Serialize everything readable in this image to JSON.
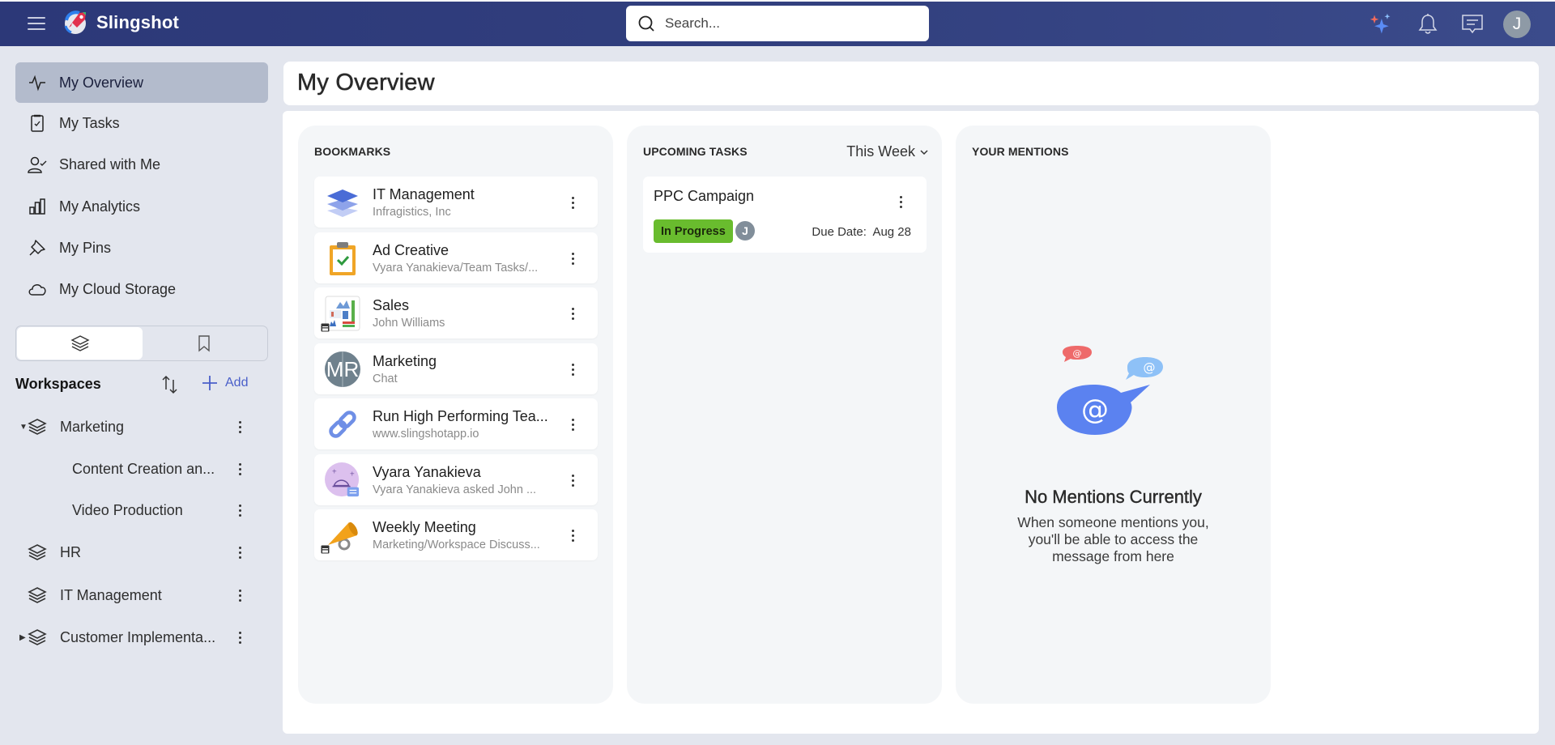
{
  "app": {
    "brand": "Slingshot",
    "search_placeholder": "Search...",
    "user_initial": "J",
    "colors": {
      "header": "#2f3b7a",
      "accent": "#4a5fc9",
      "in_progress": "#69bc2e",
      "active_nav": "#b3bbcc"
    }
  },
  "sidebar": {
    "nav": [
      {
        "label": "My Overview",
        "icon": "activity-icon",
        "active": true
      },
      {
        "label": "My Tasks",
        "icon": "clipboard-check-icon"
      },
      {
        "label": "Shared with Me",
        "icon": "user-check-icon"
      },
      {
        "label": "My Analytics",
        "icon": "bar-chart-icon"
      },
      {
        "label": "My Pins",
        "icon": "pin-icon"
      },
      {
        "label": "My Cloud Storage",
        "icon": "cloud-icon"
      }
    ],
    "toggle": {
      "selected": "workspaces",
      "options": [
        "workspaces",
        "bookmarks"
      ]
    },
    "workspaces_title": "Workspaces",
    "add_label": "Add",
    "tree": [
      {
        "label": "Marketing",
        "level": 0,
        "expanded": true,
        "has_children": true
      },
      {
        "label": "Content Creation an...",
        "level": 1
      },
      {
        "label": "Video Production",
        "level": 1
      },
      {
        "label": "HR",
        "level": 0
      },
      {
        "label": "IT Management",
        "level": 0
      },
      {
        "label": "Customer Implementa...",
        "level": 0,
        "expanded": false,
        "has_children": true
      }
    ]
  },
  "main": {
    "title": "My Overview",
    "bookmarks": {
      "title": "BOOKMARKS",
      "items": [
        {
          "title": "IT Management",
          "subtitle": "Infragistics, Inc",
          "icon": "workspace-layers-icon"
        },
        {
          "title": "Ad Creative",
          "subtitle": "Vyara Yanakieva/Team Tasks/...",
          "icon": "task-clipboard-icon"
        },
        {
          "title": "Sales",
          "subtitle": "John Williams",
          "icon": "dashboard-thumbnail-icon"
        },
        {
          "title": "Marketing",
          "subtitle": "Chat",
          "icon": "chat-avatar-icon",
          "initials": "MR"
        },
        {
          "title": "Run High Performing Tea...",
          "subtitle": "www.slingshotapp.io",
          "icon": "link-icon"
        },
        {
          "title": "Vyara Yanakieva",
          "subtitle": "Vyara Yanakieva asked John ...",
          "icon": "chat-message-icon"
        },
        {
          "title": "Weekly Meeting",
          "subtitle": "Marketing/Workspace Discuss...",
          "icon": "megaphone-icon"
        }
      ]
    },
    "tasks": {
      "title": "UPCOMING TASKS",
      "range": "This Week",
      "items": [
        {
          "name": "PPC Campaign",
          "status": "In Progress",
          "assignee": "J",
          "due_label": "Due Date:",
          "due": "Aug 28"
        }
      ]
    },
    "mentions": {
      "title": "YOUR MENTIONS",
      "empty_title": "No Mentions Currently",
      "empty_text": "When someone mentions you, you'll be able to access the message from here",
      "at": "@"
    }
  }
}
